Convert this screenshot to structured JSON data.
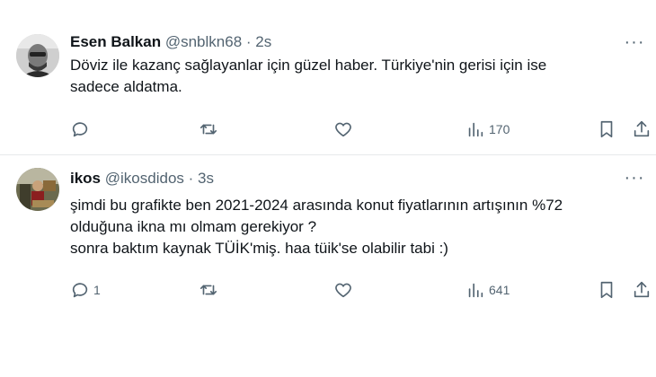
{
  "tweets": [
    {
      "name": "Esen Balkan",
      "handle": "@snblkn68",
      "separator": "·",
      "time": "2s",
      "more": "···",
      "lines": [
        "Döviz ile kazanç sağlayanlar için güzel haber. Türkiye'nin gerisi için ise",
        "sadece aldatma."
      ],
      "actions": {
        "replies": "",
        "retweets": "",
        "likes": "",
        "views": "170"
      }
    },
    {
      "name": "ikos",
      "handle": "@ikosdidos",
      "separator": "·",
      "time": "3s",
      "more": "···",
      "lines": [
        "şimdi bu grafikte ben 2021-2024 arasında konut fiyatlarının artışının %72",
        "olduğuna ikna mı olmam gerekiyor ?",
        "sonra baktım kaynak TÜİK'miş. haa tüik'se olabilir tabi :)"
      ],
      "actions": {
        "replies": "1",
        "retweets": "",
        "likes": "",
        "views": "641"
      }
    }
  ],
  "colors": {
    "text": "#0f1419",
    "muted": "#536471",
    "divider": "#e7e9ea"
  }
}
